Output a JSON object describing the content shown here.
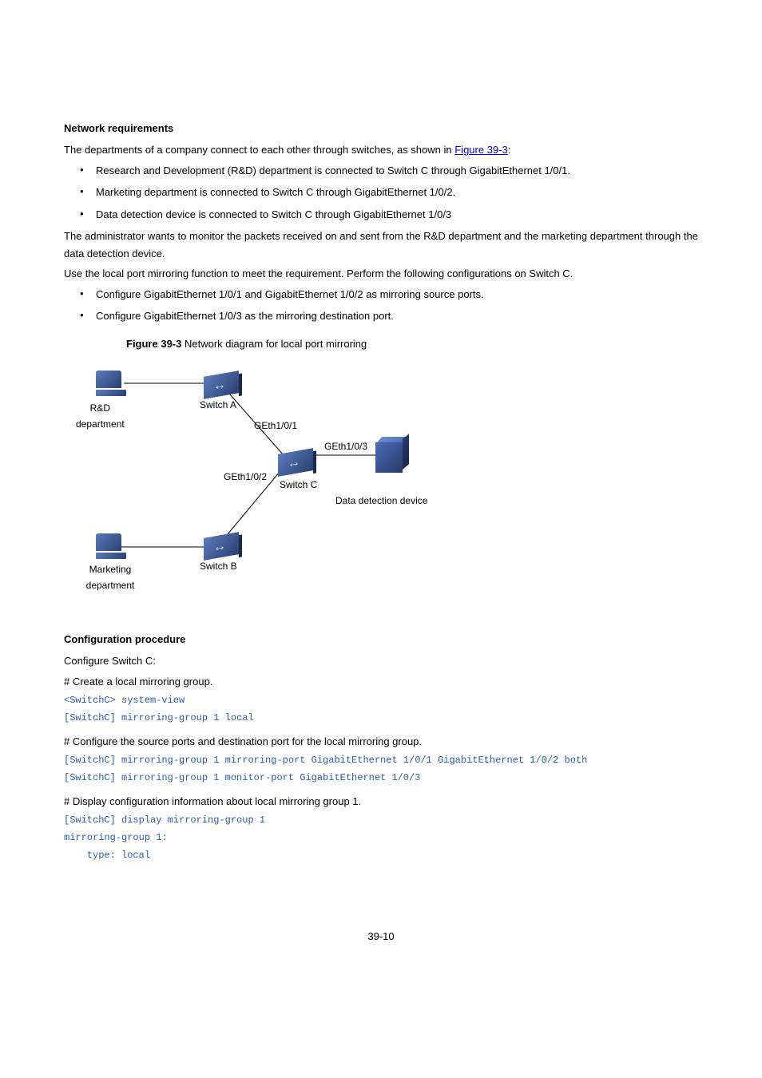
{
  "sections": {
    "network_req_heading": "Network requirements",
    "intro_prefix": "The departments of a company connect to each other through switches, as shown in ",
    "figure_link": "Figure 39-3",
    "intro_suffix": ":",
    "bullets1": [
      "Research and Development (R&D) department is connected to Switch C through GigabitEthernet 1/0/1.",
      "Marketing department is connected to Switch C through GigabitEthernet 1/0/2.",
      "Data detection device is connected to Switch C through GigabitEthernet 1/0/3"
    ],
    "para1": "The administrator wants to monitor the packets received on and sent from the R&D department and the marketing department through the data detection device.",
    "para2": "Use the local port mirroring function to meet the requirement. Perform the following configurations on Switch C.",
    "bullets2": [
      "Configure GigabitEthernet 1/0/1 and GigabitEthernet 1/0/2 as mirroring source ports.",
      "Configure GigabitEthernet 1/0/3 as the mirroring destination port."
    ],
    "figure_caption_prefix": "Figure 39-3 ",
    "figure_caption": "Network diagram for local port mirroring",
    "diagram": {
      "rd_label": "R&D department",
      "switch_a": "Switch A",
      "switch_b": "Switch B",
      "switch_c": "Switch C",
      "marketing": "Marketing department",
      "data_device": "Data detection device",
      "ge101": "GEth1/0/1",
      "ge102": "GEth1/0/2",
      "ge103": "GEth1/0/3"
    },
    "config_heading": "Configuration procedure",
    "config_line": "Configure Switch C:",
    "step1": "# Create a local mirroring group.",
    "code1a": "<SwitchC> system-view",
    "code1b": "[SwitchC] mirroring-group 1 local",
    "step2": "# Configure the source ports and destination port for the local mirroring group.",
    "code2a": "[SwitchC] mirroring-group 1 mirroring-port GigabitEthernet 1/0/1 GigabitEthernet 1/0/2 both",
    "code2b": "[SwitchC] mirroring-group 1 monitor-port GigabitEthernet 1/0/3",
    "step3": "# Display configuration information about local mirroring group 1.",
    "code3a": "[SwitchC] display mirroring-group 1",
    "code3b": "mirroring-group 1:",
    "code3c": "    type: local",
    "pagenum": "39-10"
  }
}
